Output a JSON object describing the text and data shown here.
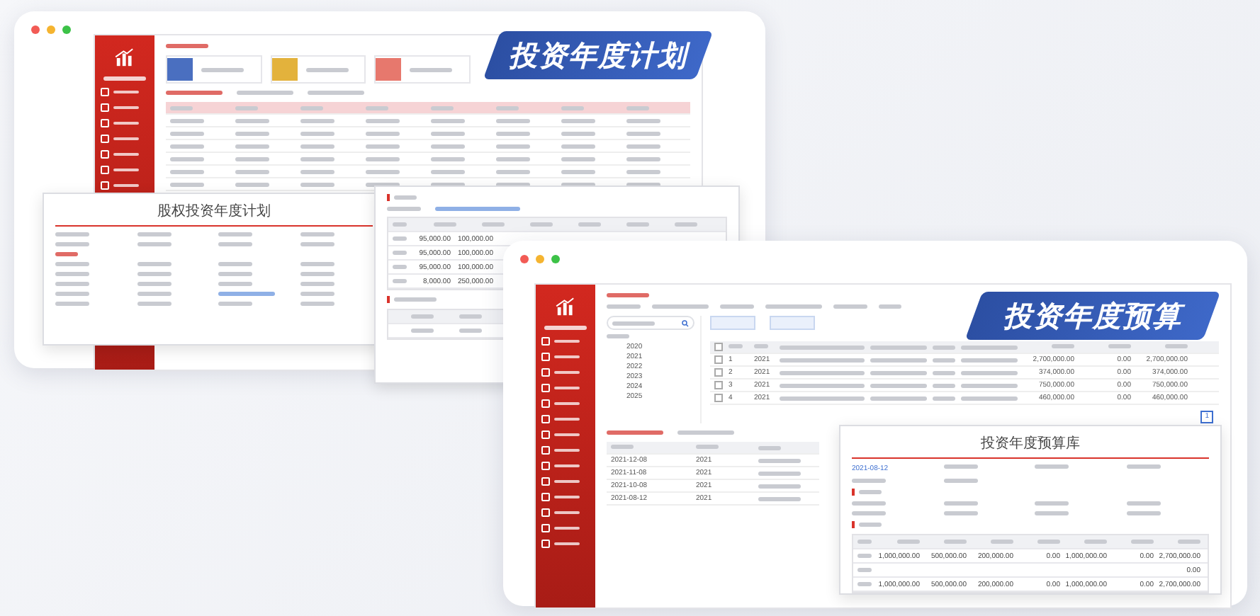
{
  "plan_window": {
    "tiles": [
      {
        "color": "#4a6fc0"
      },
      {
        "color": "#e3b23c"
      },
      {
        "color": "#e7786d"
      }
    ]
  },
  "plan_banner": {
    "text": "投资年度计划"
  },
  "plan_detail": {
    "title": "股权投资年度计划"
  },
  "plan_funding": {
    "rows": [
      {
        "cells": [
          "95,000.00",
          "100,000.00"
        ]
      },
      {
        "cells": [
          "95,000.00",
          "100,000.00"
        ]
      },
      {
        "cells": [
          "95,000.00",
          "100,000.00"
        ]
      },
      {
        "cells": [
          "8,000.00",
          "250,000.00"
        ]
      }
    ]
  },
  "budget_window": {
    "select_all_checked": false,
    "tree_years": [
      "2020",
      "2021",
      "2022",
      "2023",
      "2024",
      "2025"
    ],
    "rows": [
      {
        "checked": false,
        "no": "1",
        "year": "2021",
        "current": "2,700,000.00",
        "adjust": "0.00",
        "total": "2,700,000.00"
      },
      {
        "checked": false,
        "no": "2",
        "year": "2021",
        "current": "374,000.00",
        "adjust": "0.00",
        "total": "374,000.00"
      },
      {
        "checked": false,
        "no": "3",
        "year": "2021",
        "current": "750,000.00",
        "adjust": "0.00",
        "total": "750,000.00"
      },
      {
        "checked": false,
        "no": "4",
        "year": "2021",
        "current": "460,000.00",
        "adjust": "0.00",
        "total": "460,000.00"
      }
    ],
    "page": "1",
    "history": [
      {
        "date": "2021-12-08",
        "year": "2021"
      },
      {
        "date": "2021-11-08",
        "year": "2021"
      },
      {
        "date": "2021-10-08",
        "year": "2021"
      },
      {
        "date": "2021-08-12",
        "year": "2021"
      }
    ]
  },
  "budget_banner": {
    "text": "投资年度预算"
  },
  "budget_detail": {
    "title": "投资年度预算库",
    "date": "2021-08-12",
    "rows": [
      {
        "cells": [
          "1,000,000.00",
          "500,000.00",
          "200,000.00",
          "0.00",
          "1,000,000.00",
          "0.00",
          "2,700,000.00"
        ]
      },
      {
        "cells": [
          "",
          "",
          "",
          "",
          "",
          "",
          "0.00"
        ]
      },
      {
        "cells": [
          "1,000,000.00",
          "500,000.00",
          "200,000.00",
          "0.00",
          "1,000,000.00",
          "0.00",
          "2,700,000.00"
        ]
      }
    ]
  }
}
